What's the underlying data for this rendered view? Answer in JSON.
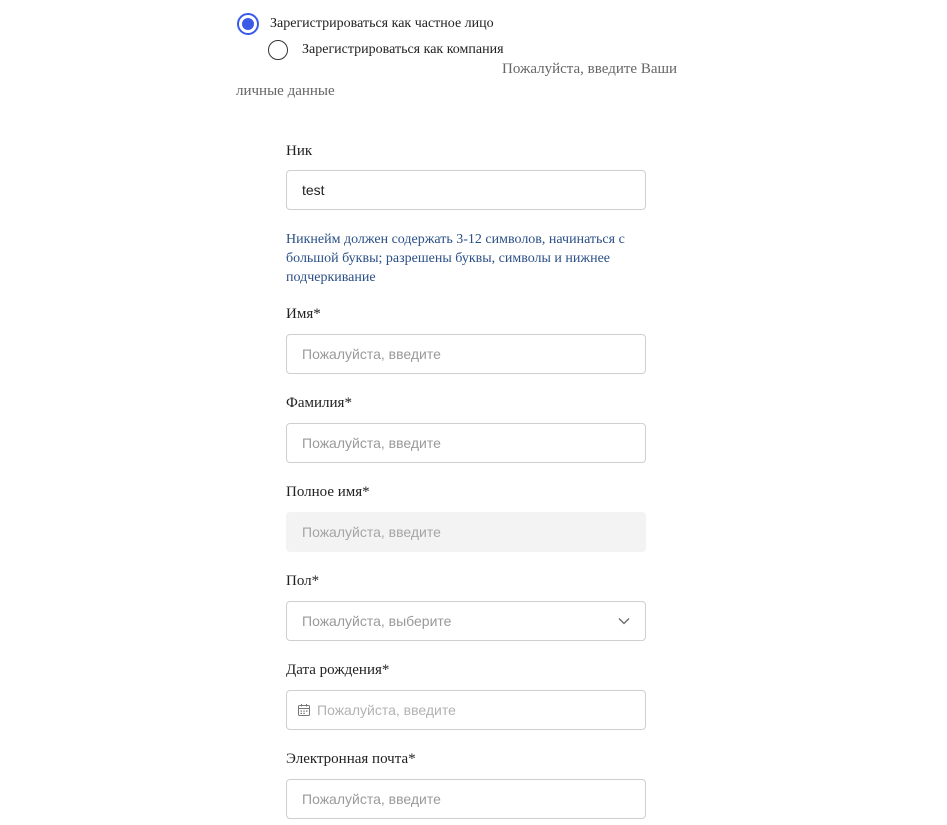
{
  "account_type": {
    "options": [
      {
        "label": "Зарегистрироваться как частное лицо",
        "selected": true
      },
      {
        "label": "Зарегистрироваться как компания",
        "selected": false
      }
    ]
  },
  "intro_text": "Пожалуйста, введите Ваши личные данные",
  "colors": {
    "accent": "#3c5ae8",
    "hint": "#2a4f86",
    "disabled_bg": "#f3f3f3"
  },
  "form": {
    "nick": {
      "label": "Ник",
      "value": "test"
    },
    "nick_hint": "Никнейм должен содержать 3-12 символов, начинаться с большой буквы; разрешены буквы, символы и нижнее подчеркивание",
    "first_name": {
      "label": "Имя*",
      "placeholder": "Пожалуйста, введите"
    },
    "last_name": {
      "label": "Фамилия*",
      "placeholder": "Пожалуйста, введите"
    },
    "full_name": {
      "label": "Полное имя*",
      "placeholder": "Пожалуйста, введите",
      "disabled": true
    },
    "gender": {
      "label": "Пол*",
      "placeholder": "Пожалуйста, выберите",
      "icon": "chevron-down-icon"
    },
    "birth_date": {
      "label": "Дата рождения*",
      "placeholder": "Пожалуйста, введите",
      "icon": "calendar-icon"
    },
    "email": {
      "label": "Электронная почта*",
      "placeholder": "Пожалуйста, введите"
    }
  }
}
